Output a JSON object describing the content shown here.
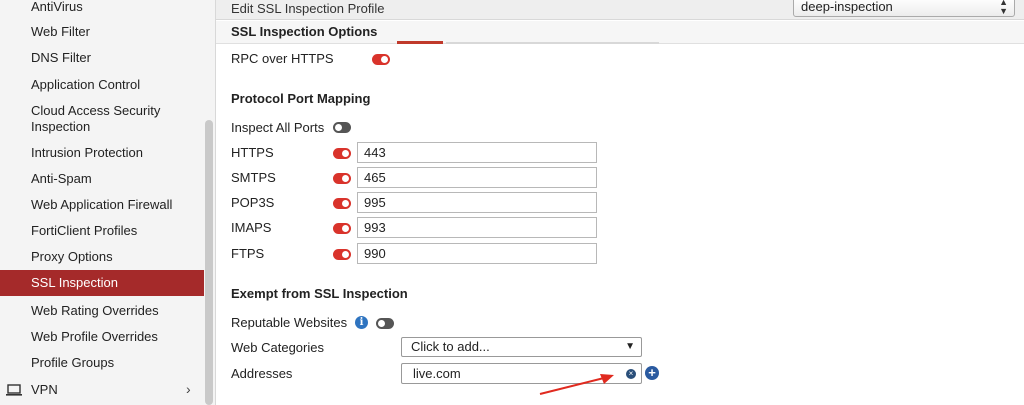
{
  "sidebar": {
    "items": [
      {
        "label": "AntiVirus",
        "active": false
      },
      {
        "label": "Web Filter",
        "active": false
      },
      {
        "label": "DNS Filter",
        "active": false
      },
      {
        "label": "Application Control",
        "active": false
      },
      {
        "label": "Cloud Access Security",
        "label2": "Inspection",
        "active": false
      },
      {
        "label": "Intrusion Protection",
        "active": false
      },
      {
        "label": "Anti-Spam",
        "active": false
      },
      {
        "label": "Web Application Firewall",
        "active": false
      },
      {
        "label": "FortiClient Profiles",
        "active": false
      },
      {
        "label": "Proxy Options",
        "active": false
      },
      {
        "label": "SSL Inspection",
        "active": true
      },
      {
        "label": "Web Rating Overrides",
        "active": false
      },
      {
        "label": "Web Profile Overrides",
        "active": false
      },
      {
        "label": "Profile Groups",
        "active": false
      },
      {
        "label": "VPN",
        "active": false,
        "icon": "laptop-icon",
        "chevron": "›"
      }
    ]
  },
  "header": {
    "title": "Edit SSL Inspection Profile",
    "profile_select": "deep-inspection"
  },
  "section": {
    "title": "SSL Inspection Options"
  },
  "rpc": {
    "label": "RPC over HTTPS",
    "enabled": true
  },
  "ports": {
    "heading": "Protocol Port Mapping",
    "inspect_all_label": "Inspect All Ports",
    "inspect_all_enabled": false,
    "rows": [
      {
        "protocol": "HTTPS",
        "enabled": true,
        "port": "443"
      },
      {
        "protocol": "SMTPS",
        "enabled": true,
        "port": "465"
      },
      {
        "protocol": "POP3S",
        "enabled": true,
        "port": "995"
      },
      {
        "protocol": "IMAPS",
        "enabled": true,
        "port": "993"
      },
      {
        "protocol": "FTPS",
        "enabled": true,
        "port": "990"
      }
    ]
  },
  "exempt": {
    "heading": "Exempt from SSL Inspection",
    "reputable_label": "Reputable Websites",
    "reputable_enabled": false,
    "info_icon": "i",
    "web_categories_label": "Web Categories",
    "web_categories_value": "Click to add...",
    "addresses_label": "Addresses",
    "address_value": "live.com",
    "remove_glyph": "×",
    "add_glyph": "+"
  },
  "colors": {
    "active_item": "#a52a2a",
    "toggle_on": "#d9332b",
    "annotation_arrow": "#e02a1f"
  }
}
